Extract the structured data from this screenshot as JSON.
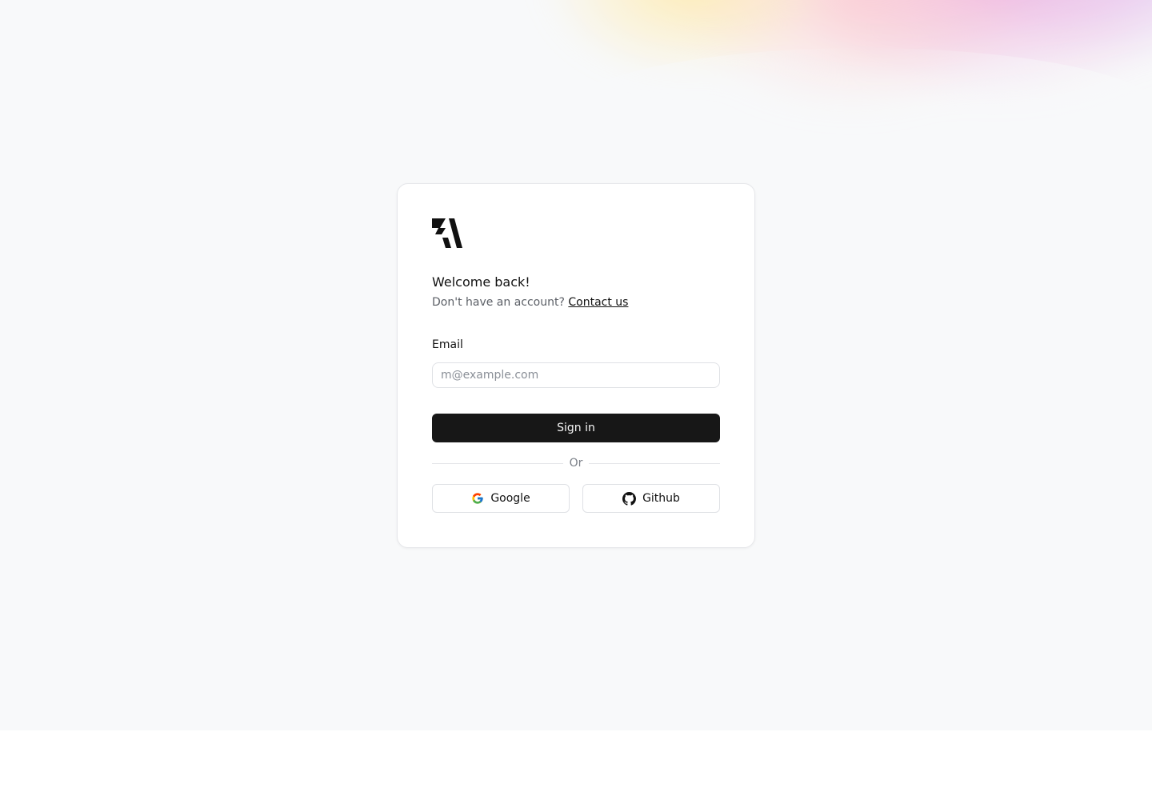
{
  "brand": {
    "logo_icon": "brand-logo-icon"
  },
  "login": {
    "title": "Welcome back!",
    "subtitle_prefix": "Don't have an account?",
    "contact_link": "Contact us",
    "email_label": "Email",
    "email_value": "",
    "email_placeholder": "m@example.com",
    "signin_label": "Sign in",
    "divider_label": "Or",
    "google_label": "Google",
    "google_icon": "google-icon",
    "github_label": "Github",
    "github_icon": "github-icon"
  },
  "colors": {
    "page_background": "#f8f9fa",
    "card_background": "#ffffff",
    "primary_button": "#171717",
    "text": "#111111",
    "muted_text": "#5b5f66"
  }
}
